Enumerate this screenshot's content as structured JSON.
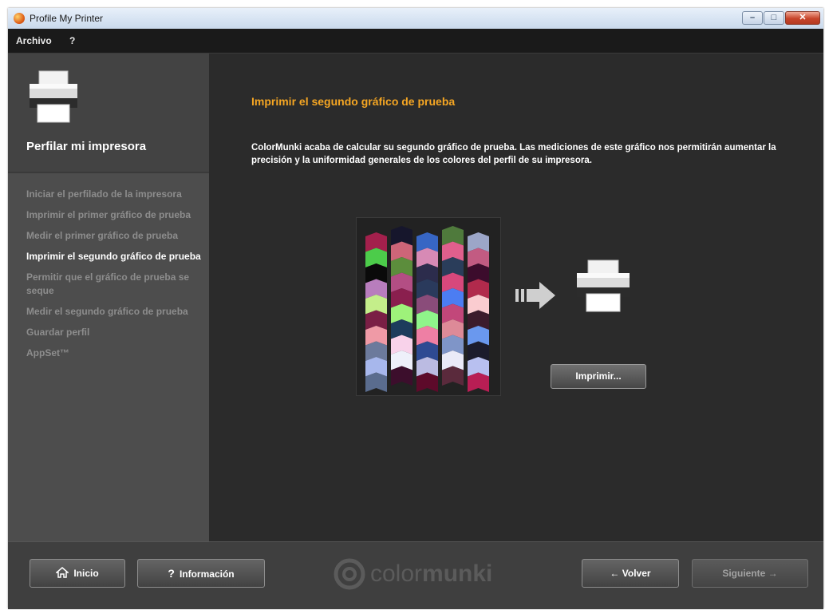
{
  "window": {
    "title": "Profile My Printer",
    "minimize": "–",
    "maximize": "□",
    "close": "✕"
  },
  "menu": {
    "items": [
      "Archivo",
      "?"
    ]
  },
  "sidebar": {
    "title": "Perfilar mi impresora",
    "steps": [
      {
        "label": "Iniciar el perfilado de la impresora",
        "active": false
      },
      {
        "label": "Imprimir el primer gráfico de prueba",
        "active": false
      },
      {
        "label": "Medir el primer gráfico de prueba",
        "active": false
      },
      {
        "label": "Imprimir el segundo gráfico de prueba",
        "active": true
      },
      {
        "label": "Permitir que el gráfico de prueba se seque",
        "active": false
      },
      {
        "label": "Medir el segundo gráfico de prueba",
        "active": false
      },
      {
        "label": "Guardar perfil",
        "active": false
      },
      {
        "label": "AppSet™",
        "active": false
      }
    ]
  },
  "main": {
    "heading": "Imprimir el segundo gráfico de prueba",
    "description": "ColorMunki acaba de calcular su segundo gráfico de prueba. Las mediciones de este gráfico nos permitirán aumentar la precisión y la uniformidad generales de los colores del perfil de su impresora.",
    "print_button": "Imprimir..."
  },
  "test_chart_colors": [
    [
      "#a3204c",
      "#4ccc4a",
      "#0a0a0a",
      "#b87dbd",
      "#c4ee8a",
      "#7a1f45",
      "#ef9aa6",
      "#6c7a9c",
      "#a7b7ec",
      "#5a6c8e"
    ],
    [
      "#16162c",
      "#cd6578",
      "#5c8d3c",
      "#b34e84",
      "#8a1f4e",
      "#9ef27a",
      "#1c3c5c",
      "#f8d2ea",
      "#eef0fa",
      "#3c0e2c"
    ],
    [
      "#3766c4",
      "#d78ab5",
      "#2c2c4c",
      "#2a3a5c",
      "#8a4c7a",
      "#8ff48a",
      "#ee7fa4",
      "#2e4a92",
      "#bbbbe2",
      "#5d0a2a"
    ],
    [
      "#4f7a3c",
      "#e05f8d",
      "#2a3d5a",
      "#d7487c",
      "#4c7df2",
      "#c2477a",
      "#dd8a98",
      "#7f95c8",
      "#eaeaf8",
      "#5a2a3c"
    ],
    [
      "#9ca6c8",
      "#c25b82",
      "#3c0c2c",
      "#b12a4c",
      "#faccd0",
      "#3c1c2c",
      "#6a98ee",
      "#1c1c2c",
      "#b8c0f0",
      "#b81e54"
    ]
  ],
  "footer": {
    "home_label": "Inicio",
    "info_label": "Información",
    "info_icon": "?",
    "back_label": "← Volver",
    "next_label": "Siguiente →",
    "brand_light": "color",
    "brand_bold": "munki"
  },
  "icons": {
    "home": "home-icon",
    "help": "help-icon",
    "printer": "printer-icon",
    "arrow": "arrow-right-icon"
  },
  "colors": {
    "accent": "#f5a623",
    "background": "#2b2b2b",
    "sidebar": "#4d4d4d",
    "footer": "#3f3f3f"
  }
}
